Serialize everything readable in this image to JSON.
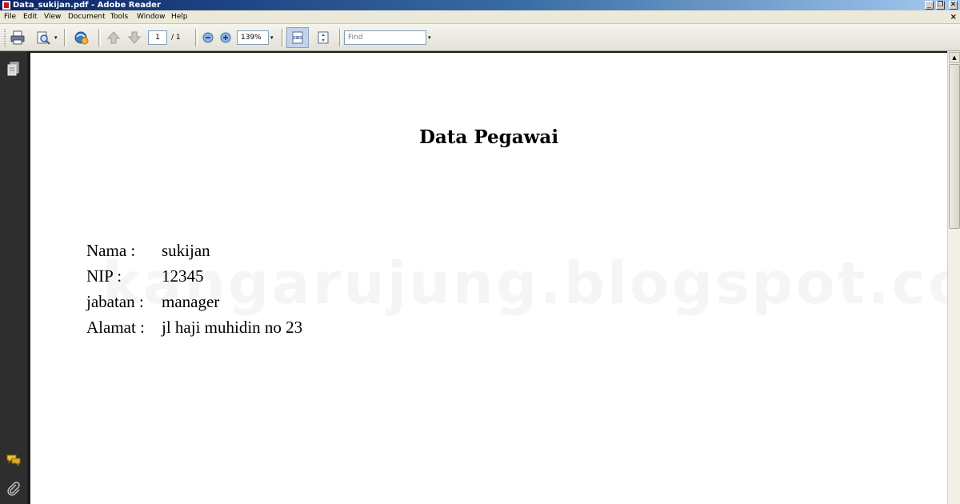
{
  "window": {
    "title": "Data_sukijan.pdf - Adobe Reader",
    "minimize_glyph": "_",
    "restore_glyph": "❐",
    "close_glyph": "✕"
  },
  "menu": {
    "items": [
      "File",
      "Edit",
      "View",
      "Document",
      "Tools",
      "Window",
      "Help"
    ],
    "doc_close_glyph": "×"
  },
  "toolbar": {
    "page_current": "1",
    "page_total": "/ 1",
    "zoom": "139%",
    "find_placeholder": "Find",
    "dropdown_glyph": "▾"
  },
  "document": {
    "title": "Data Pegawai",
    "fields": [
      {
        "label": "Nama :",
        "value": "sukijan"
      },
      {
        "label": "NIP :",
        "value": "12345"
      },
      {
        "label": "jabatan :",
        "value": "manager"
      },
      {
        "label": "Alamat :",
        "value": "jl haji muhidin no 23"
      }
    ],
    "watermark": "kangarujung.blogspot.com"
  },
  "scrollbar": {
    "up_glyph": "▲"
  },
  "icons": {
    "print": "printer-icon",
    "search_doc": "search-document-icon",
    "collaborate": "collaborate-icon",
    "prev_page": "arrow-up-icon",
    "next_page": "arrow-down-icon",
    "zoom_out": "zoom-out-icon",
    "zoom_in": "zoom-in-icon",
    "fit_width": "fit-width-icon",
    "fit_page": "fit-page-icon",
    "pages": "pages-icon",
    "comments": "comments-icon",
    "attachments": "paperclip-icon"
  },
  "colors": {
    "titlebar_start": "#0a246a",
    "navpane": "#2e2e2e",
    "page": "#ffffff"
  }
}
